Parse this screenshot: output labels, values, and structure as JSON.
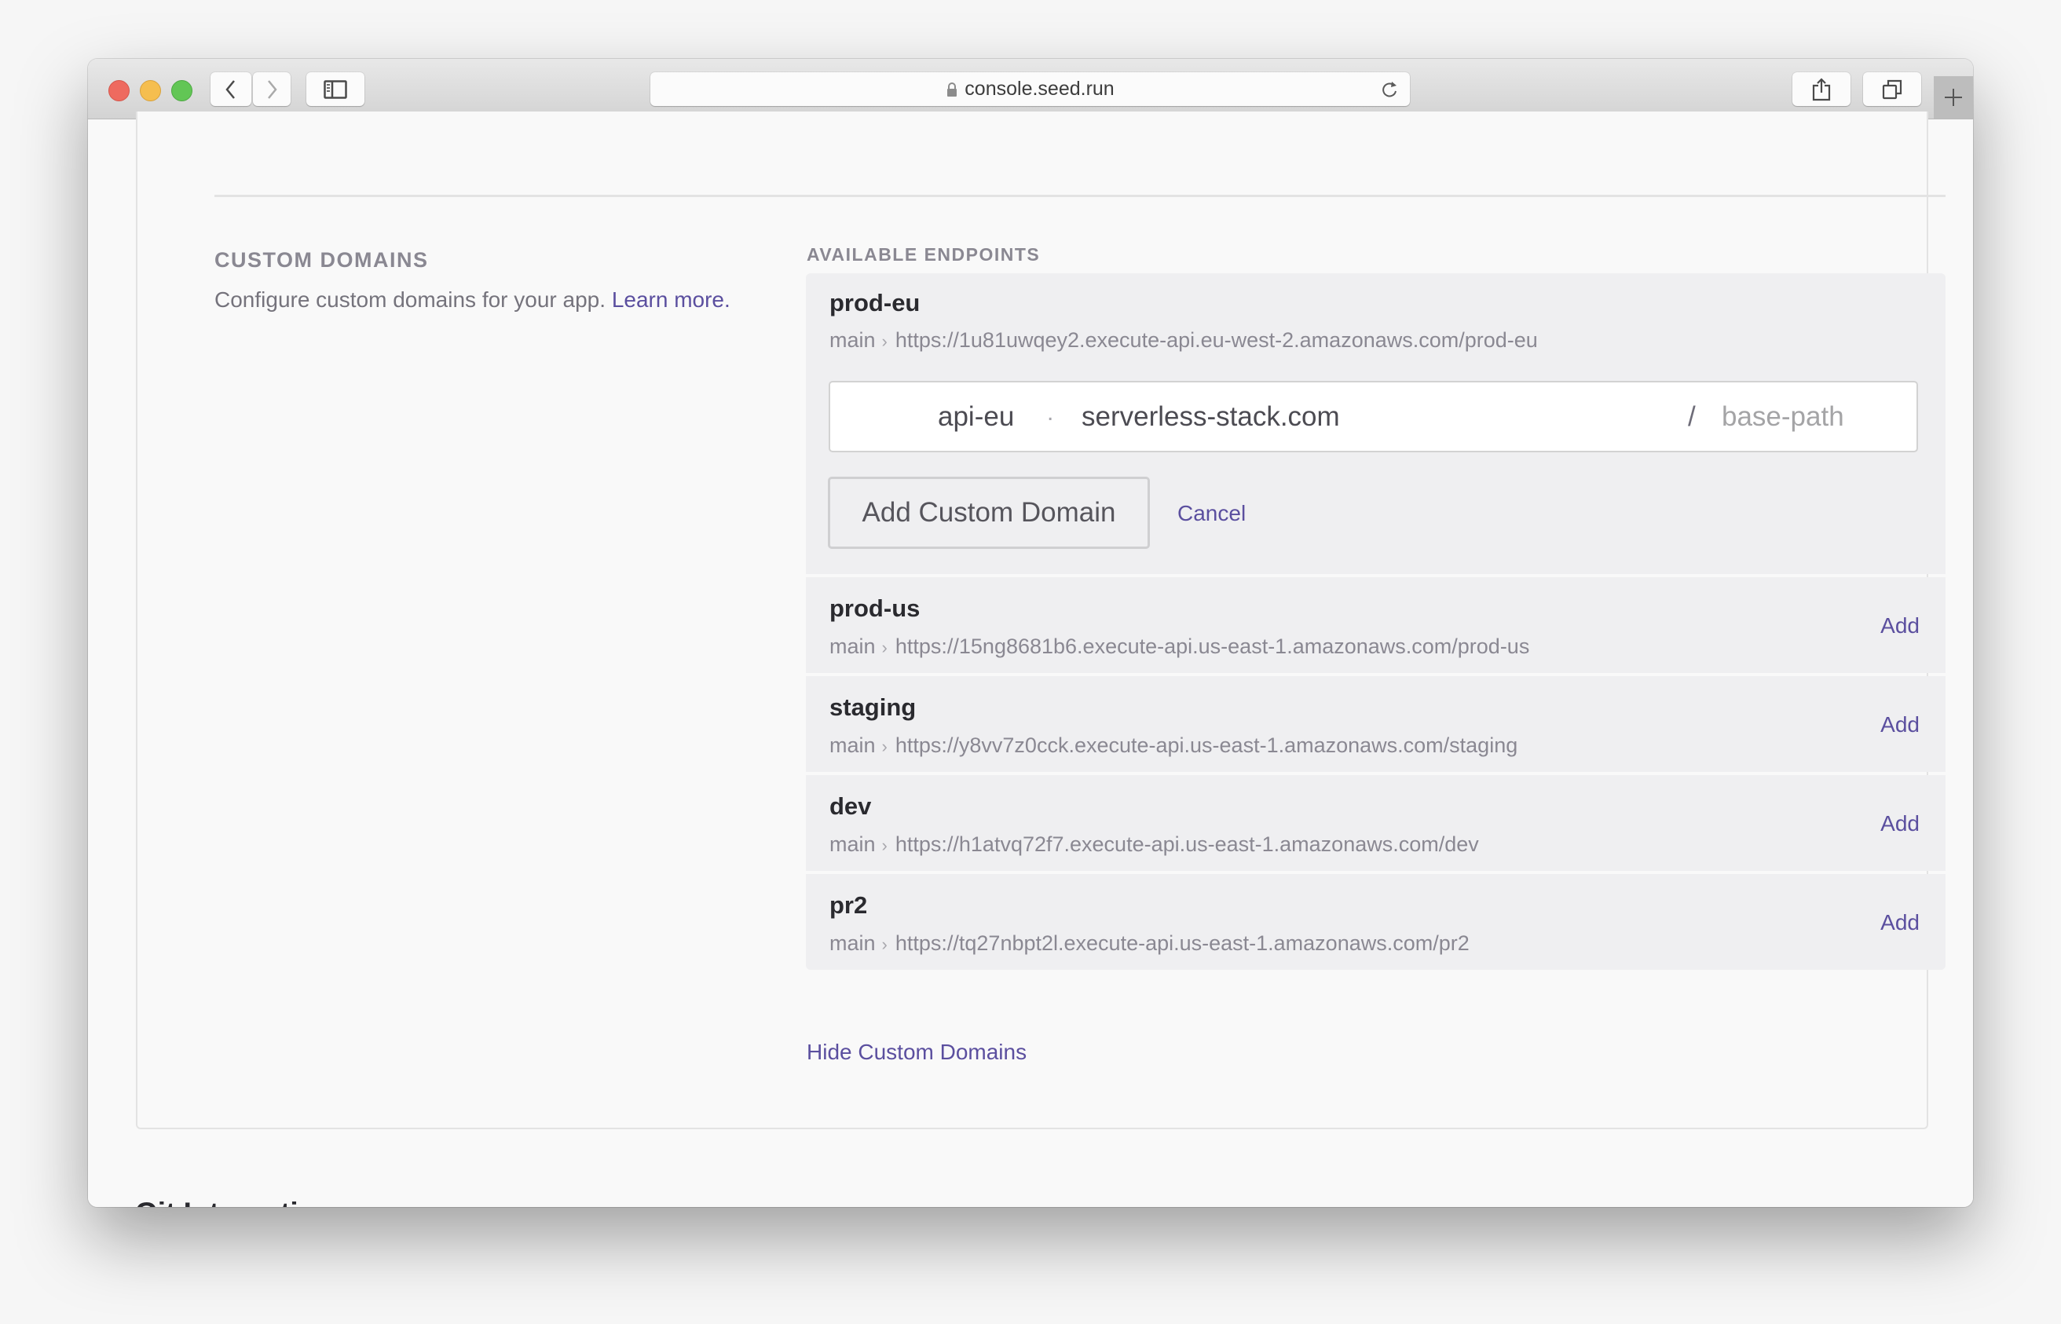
{
  "browser": {
    "url": "console.seed.run",
    "icons": {
      "back": "chevron-left-icon",
      "forward": "chevron-right-icon",
      "sidebar": "sidebar-icon",
      "lock": "lock-icon",
      "reload": "reload-icon",
      "share": "share-icon",
      "tabs": "tabs-overview-icon",
      "new_tab": "plus-icon"
    }
  },
  "custom_domains": {
    "title": "CUSTOM DOMAINS",
    "description": "Configure custom domains for your app.",
    "learn_more": "Learn more.",
    "endpoints_label": "AVAILABLE ENDPOINTS",
    "active_endpoint": {
      "name": "prod-eu",
      "branch": "main",
      "url": "https://1u81uwqey2.execute-api.eu-west-2.amazonaws.com/prod-eu",
      "form": {
        "subdomain_value": "api-eu",
        "dot_separator": ".",
        "domain_value": "serverless-stack.com",
        "path_separator": "/",
        "base_path_placeholder": "base-path",
        "submit_label": "Add Custom Domain",
        "cancel_label": "Cancel"
      }
    },
    "endpoints": [
      {
        "name": "prod-us",
        "branch": "main",
        "url": "https://15ng8681b6.execute-api.us-east-1.amazonaws.com/prod-us",
        "action": "Add"
      },
      {
        "name": "staging",
        "branch": "main",
        "url": "https://y8vv7z0cck.execute-api.us-east-1.amazonaws.com/staging",
        "action": "Add"
      },
      {
        "name": "dev",
        "branch": "main",
        "url": "https://h1atvq72f7.execute-api.us-east-1.amazonaws.com/dev",
        "action": "Add"
      },
      {
        "name": "pr2",
        "branch": "main",
        "url": "https://tq27nbpt2l.execute-api.us-east-1.amazonaws.com/pr2",
        "action": "Add"
      }
    ],
    "hide_label": "Hide Custom Domains"
  },
  "git_integration": {
    "title": "Git Integration"
  },
  "colors": {
    "accent": "#5b4f9f",
    "panel_bg": "#efeff1",
    "page_bg": "#f9f9f9"
  }
}
